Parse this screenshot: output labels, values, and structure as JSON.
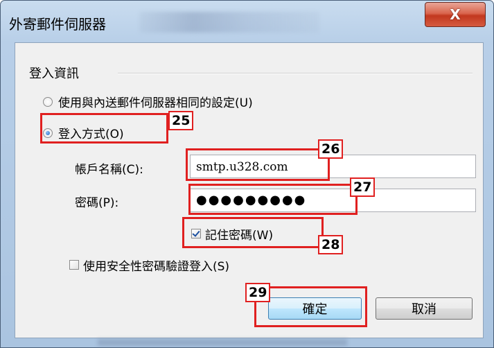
{
  "window": {
    "title": "外寄郵件伺服器",
    "close_glyph": "X"
  },
  "group": {
    "label": "登入資訊"
  },
  "options": {
    "same_as_incoming_label": "使用與內送郵件伺服器相同的設定(U)",
    "same_as_incoming_checked": false,
    "login_with_label": "登入方式(O)",
    "login_with_checked": true
  },
  "account": {
    "label": "帳戶名稱(C):",
    "value": "smtp.u328.com"
  },
  "password": {
    "label": "密碼(P):",
    "masked_value": "●●●●●●●●●"
  },
  "remember_password": {
    "label": "記住密碼(W)",
    "checked": true
  },
  "spa": {
    "label": "使用安全性密碼驗證登入(S)",
    "checked": false
  },
  "buttons": {
    "ok_label": "確定",
    "cancel_label": "取消"
  },
  "annotations": {
    "badge_25": "25",
    "badge_26": "26",
    "badge_27": "27",
    "badge_28": "28",
    "badge_29": "29",
    "color": "#e02020"
  },
  "colors": {
    "dialog_bg": "#f0f0f0",
    "titlebar": "#b8cfe8",
    "close_button": "#c2381f"
  }
}
